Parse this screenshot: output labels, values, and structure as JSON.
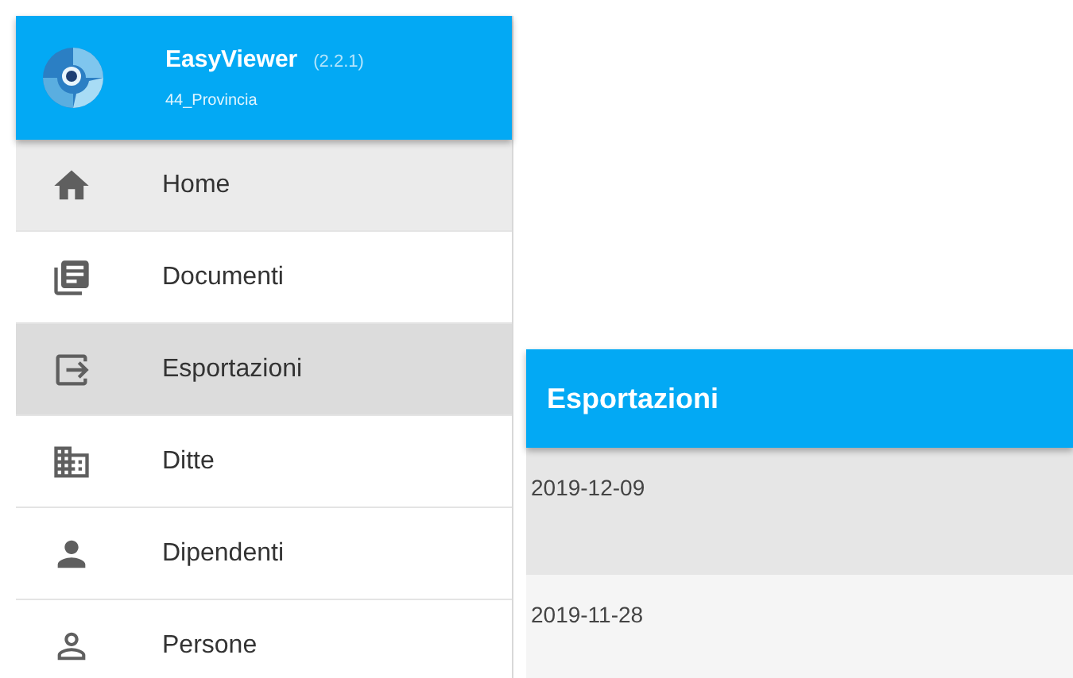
{
  "drawer": {
    "app_name": "EasyViewer",
    "version": "(2.2.1)",
    "subtitle": "44_Provincia",
    "items": [
      {
        "label": "Home",
        "kind": "home",
        "selected": false,
        "hovered": true
      },
      {
        "label": "Documenti",
        "kind": "documents",
        "selected": false,
        "hovered": false
      },
      {
        "label": "Esportazioni",
        "kind": "export",
        "selected": true,
        "hovered": false
      },
      {
        "label": "Ditte",
        "kind": "building",
        "selected": false,
        "hovered": false
      },
      {
        "label": "Dipendenti",
        "kind": "person",
        "selected": false,
        "hovered": false
      },
      {
        "label": "Persone",
        "kind": "person-outline",
        "selected": false,
        "hovered": false
      }
    ]
  },
  "panel": {
    "title": "Esportazioni",
    "rows": [
      {
        "date": "2019-12-09",
        "selected": true
      },
      {
        "date": "2019-11-28",
        "selected": false
      }
    ]
  }
}
